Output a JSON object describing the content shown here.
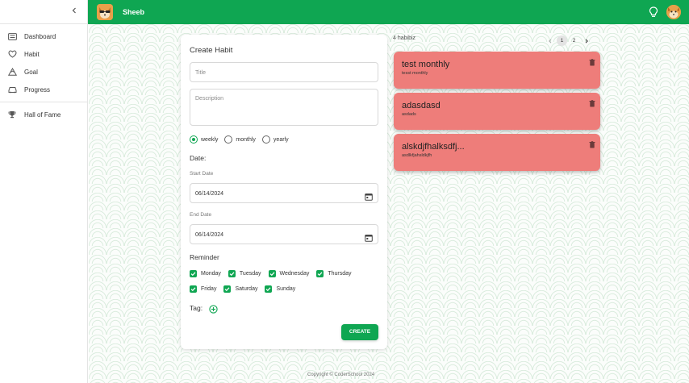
{
  "app": {
    "name": "Sheeb"
  },
  "colors": {
    "primary": "#0fa652",
    "habit_card": "#ee7d7a"
  },
  "sidebar": {
    "collapse_icon": "chevron-left-icon",
    "items": [
      {
        "label": "Dashboard",
        "icon": "dashboard-icon"
      },
      {
        "label": "Habit",
        "icon": "heart-icon"
      },
      {
        "label": "Goal",
        "icon": "mountain-icon"
      },
      {
        "label": "Progress",
        "icon": "car-icon"
      }
    ],
    "secondary": [
      {
        "label": "Hall of Fame",
        "icon": "trophy-icon"
      }
    ]
  },
  "header": {
    "right_icons": [
      "lightbulb-icon",
      "avatar"
    ]
  },
  "form": {
    "heading": "Create Habit",
    "title_placeholder": "Title",
    "description_placeholder": "Description",
    "frequency": {
      "options": [
        "weekly",
        "monthly",
        "yearly"
      ],
      "selected": "weekly"
    },
    "date_label": "Date:",
    "start_label": "Start Date",
    "start_value": "06/14/2024",
    "end_label": "End Date",
    "end_value": "06/14/2024",
    "reminder_label": "Reminder",
    "days": [
      "Monday",
      "Tuesday",
      "Wednesday",
      "Thursday",
      "Friday",
      "Saturday",
      "Sunday"
    ],
    "days_checked": [
      true,
      true,
      true,
      true,
      true,
      true,
      true
    ],
    "tag_label": "Tag:",
    "create_label": "CREATE"
  },
  "habits": {
    "count_label": "4 habibiz",
    "pagination": {
      "pages": [
        "1",
        "2"
      ],
      "current": "1"
    },
    "items": [
      {
        "title": "test monthly",
        "description": "tesst monthly"
      },
      {
        "title": "adasdasd",
        "description": "asdads"
      },
      {
        "title": "alskdjfhalksdfj...",
        "description": "asdlkfjahsldkjfh"
      }
    ]
  },
  "footer": {
    "text": "Copyright © CoderSchool 2024"
  }
}
